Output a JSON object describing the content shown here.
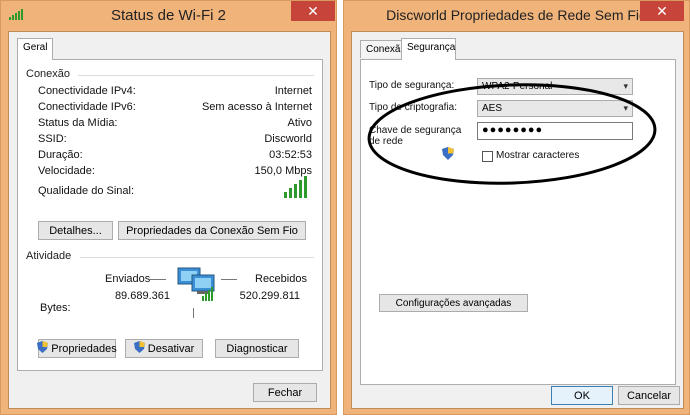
{
  "left": {
    "title": "Status de Wi-Fi 2",
    "tab_geral": "Geral",
    "connection_group": "Conexão",
    "rows": [
      {
        "label": "Conectividade IPv4:",
        "value": "Internet"
      },
      {
        "label": "Conectividade IPv6:",
        "value": "Sem acesso à Internet"
      },
      {
        "label": "Status da Mídia:",
        "value": "Ativo"
      },
      {
        "label": "SSID:",
        "value": "Discworld"
      },
      {
        "label": "Duração:",
        "value": "03:52:53"
      },
      {
        "label": "Velocidade:",
        "value": "150,0 Mbps"
      }
    ],
    "signal_label": "Qualidade do Sinal:",
    "details_button": "Detalhes...",
    "wireless_props_button": "Propriedades da Conexão Sem Fio",
    "activity_group": "Atividade",
    "sent_label": "Enviados",
    "received_label": "Recebidos",
    "bytes_label": "Bytes:",
    "sent_value": "89.689.361",
    "received_value": "520.299.811",
    "properties_button": "Propriedades",
    "disable_button": "Desativar",
    "diagnose_button": "Diagnosticar",
    "close_button": "Fechar"
  },
  "right": {
    "title": "Discworld Propriedades de Rede Sem Fio",
    "tab_conexao": "Conexão",
    "tab_seguranca": "Segurança",
    "security_type_label": "Tipo de segurança:",
    "security_type_value": "WPA2-Personal",
    "encryption_label": "Tipo de criptografia:",
    "encryption_value": "AES",
    "key_label": "Chave de segurança de rede",
    "key_value": "●●●●●●●●",
    "show_chars_label": "Mostrar caracteres",
    "advanced_button": "Configurações avançadas",
    "ok_button": "OK",
    "cancel_button": "Cancelar"
  },
  "colors": {
    "frame": "#f0b37a",
    "close": "#c7443a",
    "signal": "#2e9a2e",
    "annotation": "#000000"
  }
}
